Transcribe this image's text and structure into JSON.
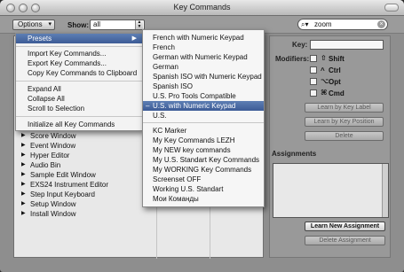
{
  "window": {
    "title": "Key Commands"
  },
  "toolbar": {
    "options_label": "Options",
    "show_label": "Show:",
    "show_value": "all",
    "search_value": "zoom",
    "search_icon": "magnifier-icon"
  },
  "options_menu": {
    "presets_label": "Presets",
    "items": [
      "Import Key Commands...",
      "Export Key Commands...",
      "Copy Key Commands to Clipboard",
      "Expand All",
      "Collapse All",
      "Scroll to Selection",
      "Initialize all Key Commands"
    ]
  },
  "presets_submenu": {
    "items": [
      "French with Numeric Keypad",
      "French",
      "German with Numeric Keypad",
      "German",
      "Spanish ISO with Numeric Keypad",
      "Spanish ISO",
      "U.S. Pro Tools Compatible",
      "U.S. with Numeric Keypad",
      "U.S.",
      "KC Marker",
      "My Key Commands LEZH",
      "My NEW key commands",
      "My U.S. Standart Key Commands",
      "My WORKING Key Commands",
      "Screenset OFF",
      "Working U.S. Standart",
      "Мои Команды"
    ],
    "selected_mark": "–"
  },
  "command_list": {
    "rows": [
      "Score Window",
      "Event Window",
      "Hyper Editor",
      "Audio Bin",
      "Sample Edit Window",
      "EXS24 Instrument Editor",
      "Step Input Keyboard",
      "Setup Window",
      "Install Window"
    ]
  },
  "right_panel": {
    "key_label": "Key:",
    "modifiers_label": "Modifiers:",
    "modifiers": [
      {
        "symbol": "⇧",
        "label": "Shift"
      },
      {
        "symbol": "^",
        "label": "Ctrl"
      },
      {
        "symbol": "⌥",
        "label": "Opt"
      },
      {
        "symbol": "⌘",
        "label": "Cmd"
      }
    ],
    "learn_by_label": "Learn by Key Label",
    "learn_by_position": "Learn by Key Position",
    "delete": "Delete",
    "assignments_label": "Assignments",
    "learn_new_assignment": "Learn New Assignment",
    "delete_assignment": "Delete Assignment"
  },
  "colors": {
    "highlight": "#4a6aa5"
  }
}
